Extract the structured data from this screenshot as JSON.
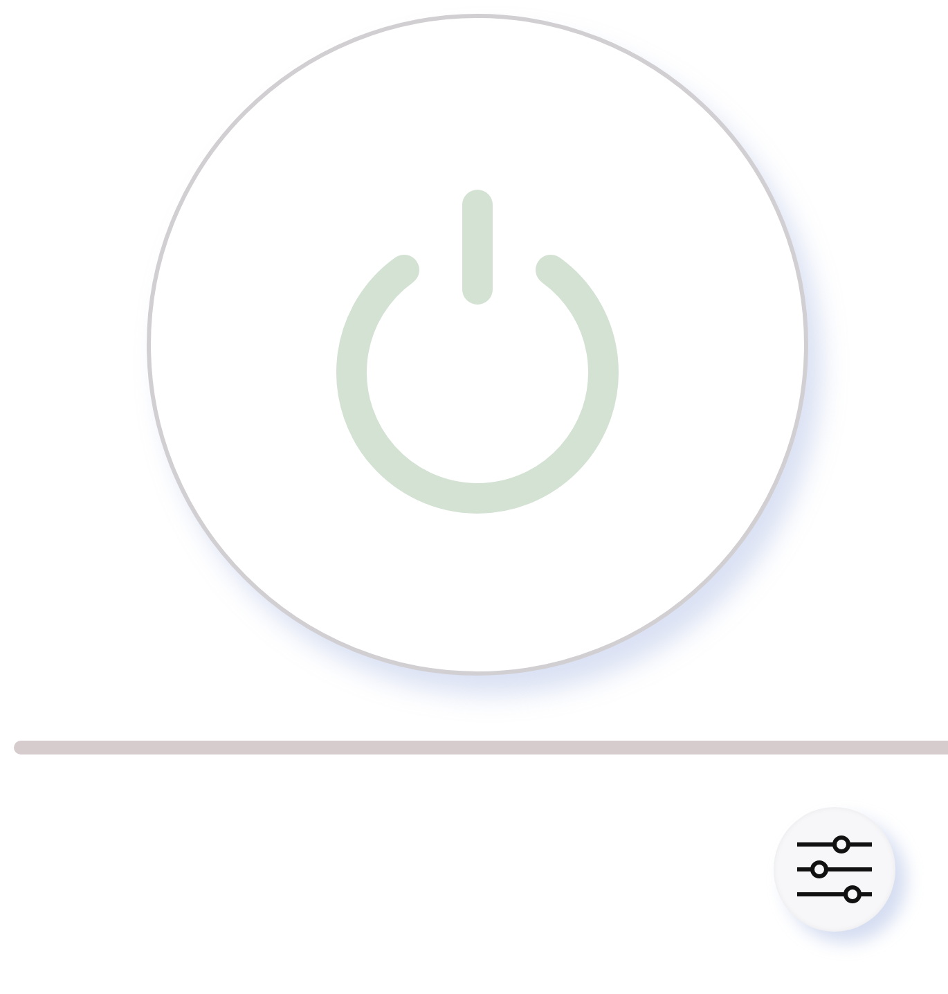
{
  "power_button": {
    "on": false
  }
}
